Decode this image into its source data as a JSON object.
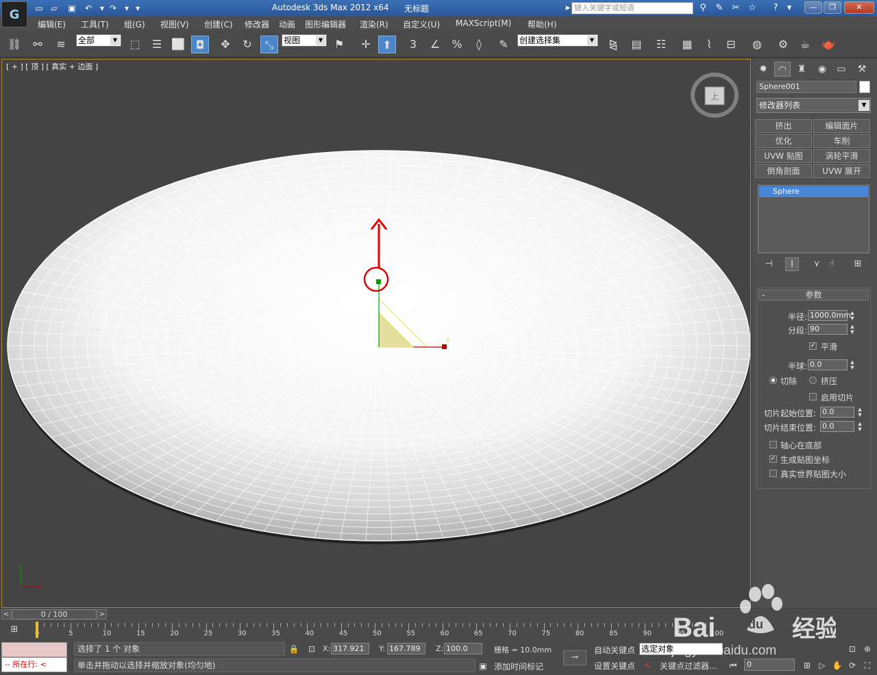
{
  "title": {
    "app": "Autodesk 3ds Max  2012 x64",
    "doc": "无标题",
    "search_placeholder": "键入关键字或短语"
  },
  "menu": [
    "编辑(E)",
    "工具(T)",
    "组(G)",
    "视图(V)",
    "创建(C)",
    "修改器",
    "动画",
    "图形编辑器",
    "渲染(R)",
    "自定义(U)",
    "MAXScript(M)",
    "帮助(H)"
  ],
  "toolbar": {
    "filter_value": "全部",
    "refcoord_value": "视图",
    "selset_value": "创建选择集",
    "snap_3_label": "3",
    "angle_label": "%"
  },
  "viewport": {
    "label": "[ + ] [ 顶 ] [ 真实 + 边面 ]",
    "viewcube_face": "上",
    "axis_x": "x",
    "axis_y": "y"
  },
  "command_panel": {
    "object_name": "Sphere001",
    "modifier_list": "修改器列表",
    "modifier_buttons": [
      "挤出",
      "编辑面片",
      "优化",
      "车削",
      "UVW 贴图",
      "涡轮平滑",
      "倒角剖面",
      "UVW 展开"
    ],
    "stack_item": "Sphere",
    "params": {
      "title": "参数",
      "collapse": "-",
      "radius_label": "半径:",
      "radius_value": "1000.0mm",
      "segments_label": "分段:",
      "segments_value": "90",
      "smooth_label": "平滑",
      "smooth_checked": true,
      "hemisphere_label": "半球:",
      "hemisphere_value": "0.0",
      "chop_label": "切除",
      "squash_label": "挤压",
      "slice_on_label": "启用切片",
      "slice_from_label": "切片起始位置:",
      "slice_from_value": "0.0",
      "slice_to_label": "切片结束位置:",
      "slice_to_value": "0.0",
      "base_pivot_label": "轴心在底部",
      "gen_coords_label": "生成贴图坐标",
      "gen_coords_checked": true,
      "real_world_label": "真实世界贴图大小"
    }
  },
  "timeline": {
    "frame_display": "0 / 100",
    "ticks": [
      "0",
      "5",
      "10",
      "15",
      "20",
      "25",
      "30",
      "35",
      "40",
      "45",
      "50",
      "55",
      "60",
      "65",
      "70",
      "75",
      "80",
      "85",
      "90",
      "95",
      "100"
    ]
  },
  "status": {
    "script_label": "所在行:",
    "selection": "选择了 1 个 对象",
    "prompt": "单击并拖动以选择并缩放对象(均匀地)",
    "x_label": "X:",
    "x_value": "317.921",
    "y_label": "Y:",
    "y_value": "167.789",
    "z_label": "Z:",
    "z_value": "100.0",
    "grid": "栅格 = 10.0mm",
    "add_time_tag": "添加时间标记",
    "auto_key": "自动关键点",
    "set_key": "设置关键点",
    "selset": "选定对象",
    "key_filters": "关键点过滤器...",
    "frame": "0"
  },
  "watermark": {
    "brand": "Bai",
    "brand2": "du",
    "text": "经验",
    "url": "jingyan.baidu.com"
  },
  "colors": {
    "accent": "#4a86c8",
    "annotation": "#e00000",
    "gizmo_y": "#00a000",
    "gizmo_x": "#c00000",
    "gizmo_plane": "#f0f060"
  }
}
